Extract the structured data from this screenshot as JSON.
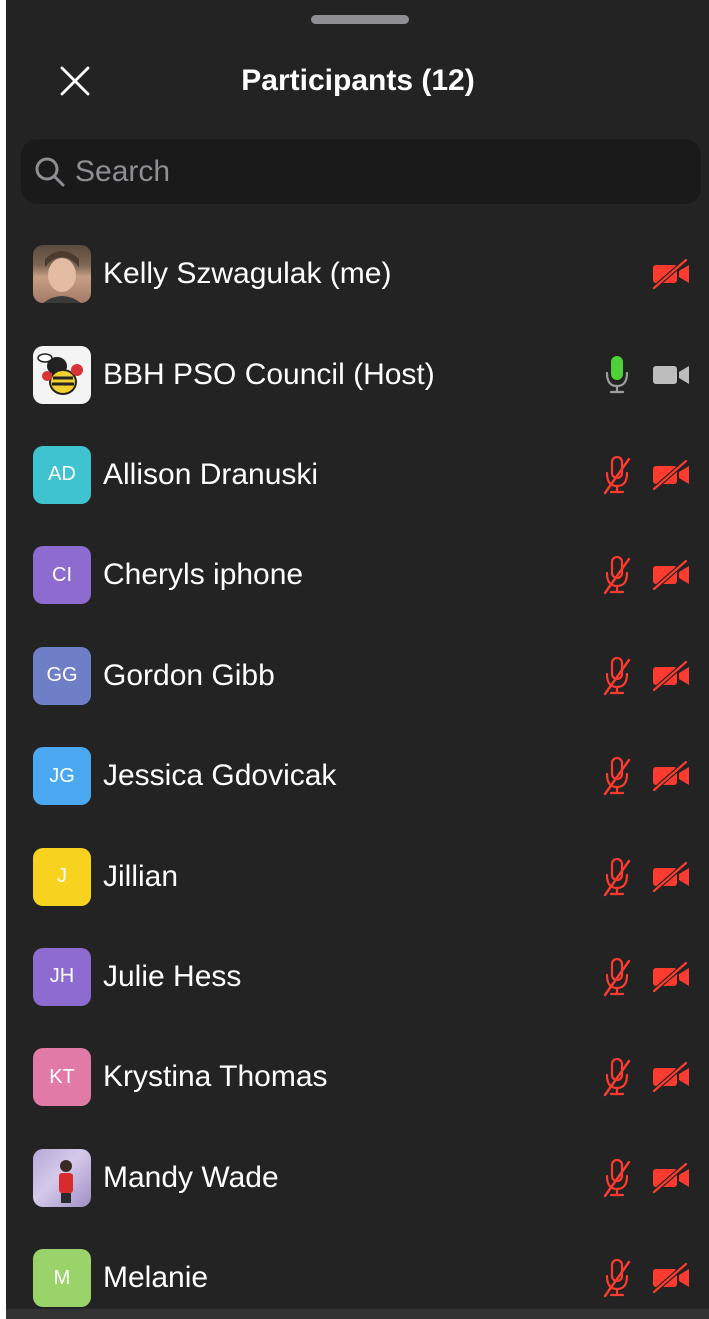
{
  "header": {
    "title": "Participants (12)"
  },
  "search": {
    "placeholder": "Search",
    "value": ""
  },
  "colors": {
    "panel_bg": "#232323",
    "muted_red": "#ff3b30",
    "mic_on_green": "#4cd137",
    "video_on_gray": "#bdbdbd"
  },
  "participants": [
    {
      "name": "Kelly Szwagulak (me)",
      "avatar_type": "photo",
      "initials": "",
      "avatar_color": "#7d6654",
      "mic": "hidden",
      "video": "off"
    },
    {
      "name": "BBH PSO Council (Host)",
      "avatar_type": "photo",
      "initials": "",
      "avatar_color": "#f4f4f4",
      "mic": "on",
      "video": "on"
    },
    {
      "name": "Allison Dranuski",
      "avatar_type": "initials",
      "initials": "AD",
      "avatar_color": "#3fc3d1",
      "mic": "muted",
      "video": "off"
    },
    {
      "name": "Cheryls iphone",
      "avatar_type": "initials",
      "initials": "CI",
      "avatar_color": "#8e6bd0",
      "mic": "muted",
      "video": "off"
    },
    {
      "name": "Gordon Gibb",
      "avatar_type": "initials",
      "initials": "GG",
      "avatar_color": "#6e7fc8",
      "mic": "muted",
      "video": "off"
    },
    {
      "name": "Jessica Gdovicak",
      "avatar_type": "initials",
      "initials": "JG",
      "avatar_color": "#4aa8f0",
      "mic": "muted",
      "video": "off"
    },
    {
      "name": "Jillian",
      "avatar_type": "initials",
      "initials": "J",
      "avatar_color": "#f7d21e",
      "mic": "muted",
      "video": "off"
    },
    {
      "name": "Julie Hess",
      "avatar_type": "initials",
      "initials": "JH",
      "avatar_color": "#8e6bd0",
      "mic": "muted",
      "video": "off"
    },
    {
      "name": "Krystina Thomas",
      "avatar_type": "initials",
      "initials": "KT",
      "avatar_color": "#e27aa8",
      "mic": "muted",
      "video": "off"
    },
    {
      "name": "Mandy Wade",
      "avatar_type": "photo",
      "initials": "",
      "avatar_color": "#b7a9d6",
      "mic": "muted",
      "video": "off"
    },
    {
      "name": "Melanie",
      "avatar_type": "initials",
      "initials": "M",
      "avatar_color": "#9ad36a",
      "mic": "muted",
      "video": "off"
    }
  ]
}
